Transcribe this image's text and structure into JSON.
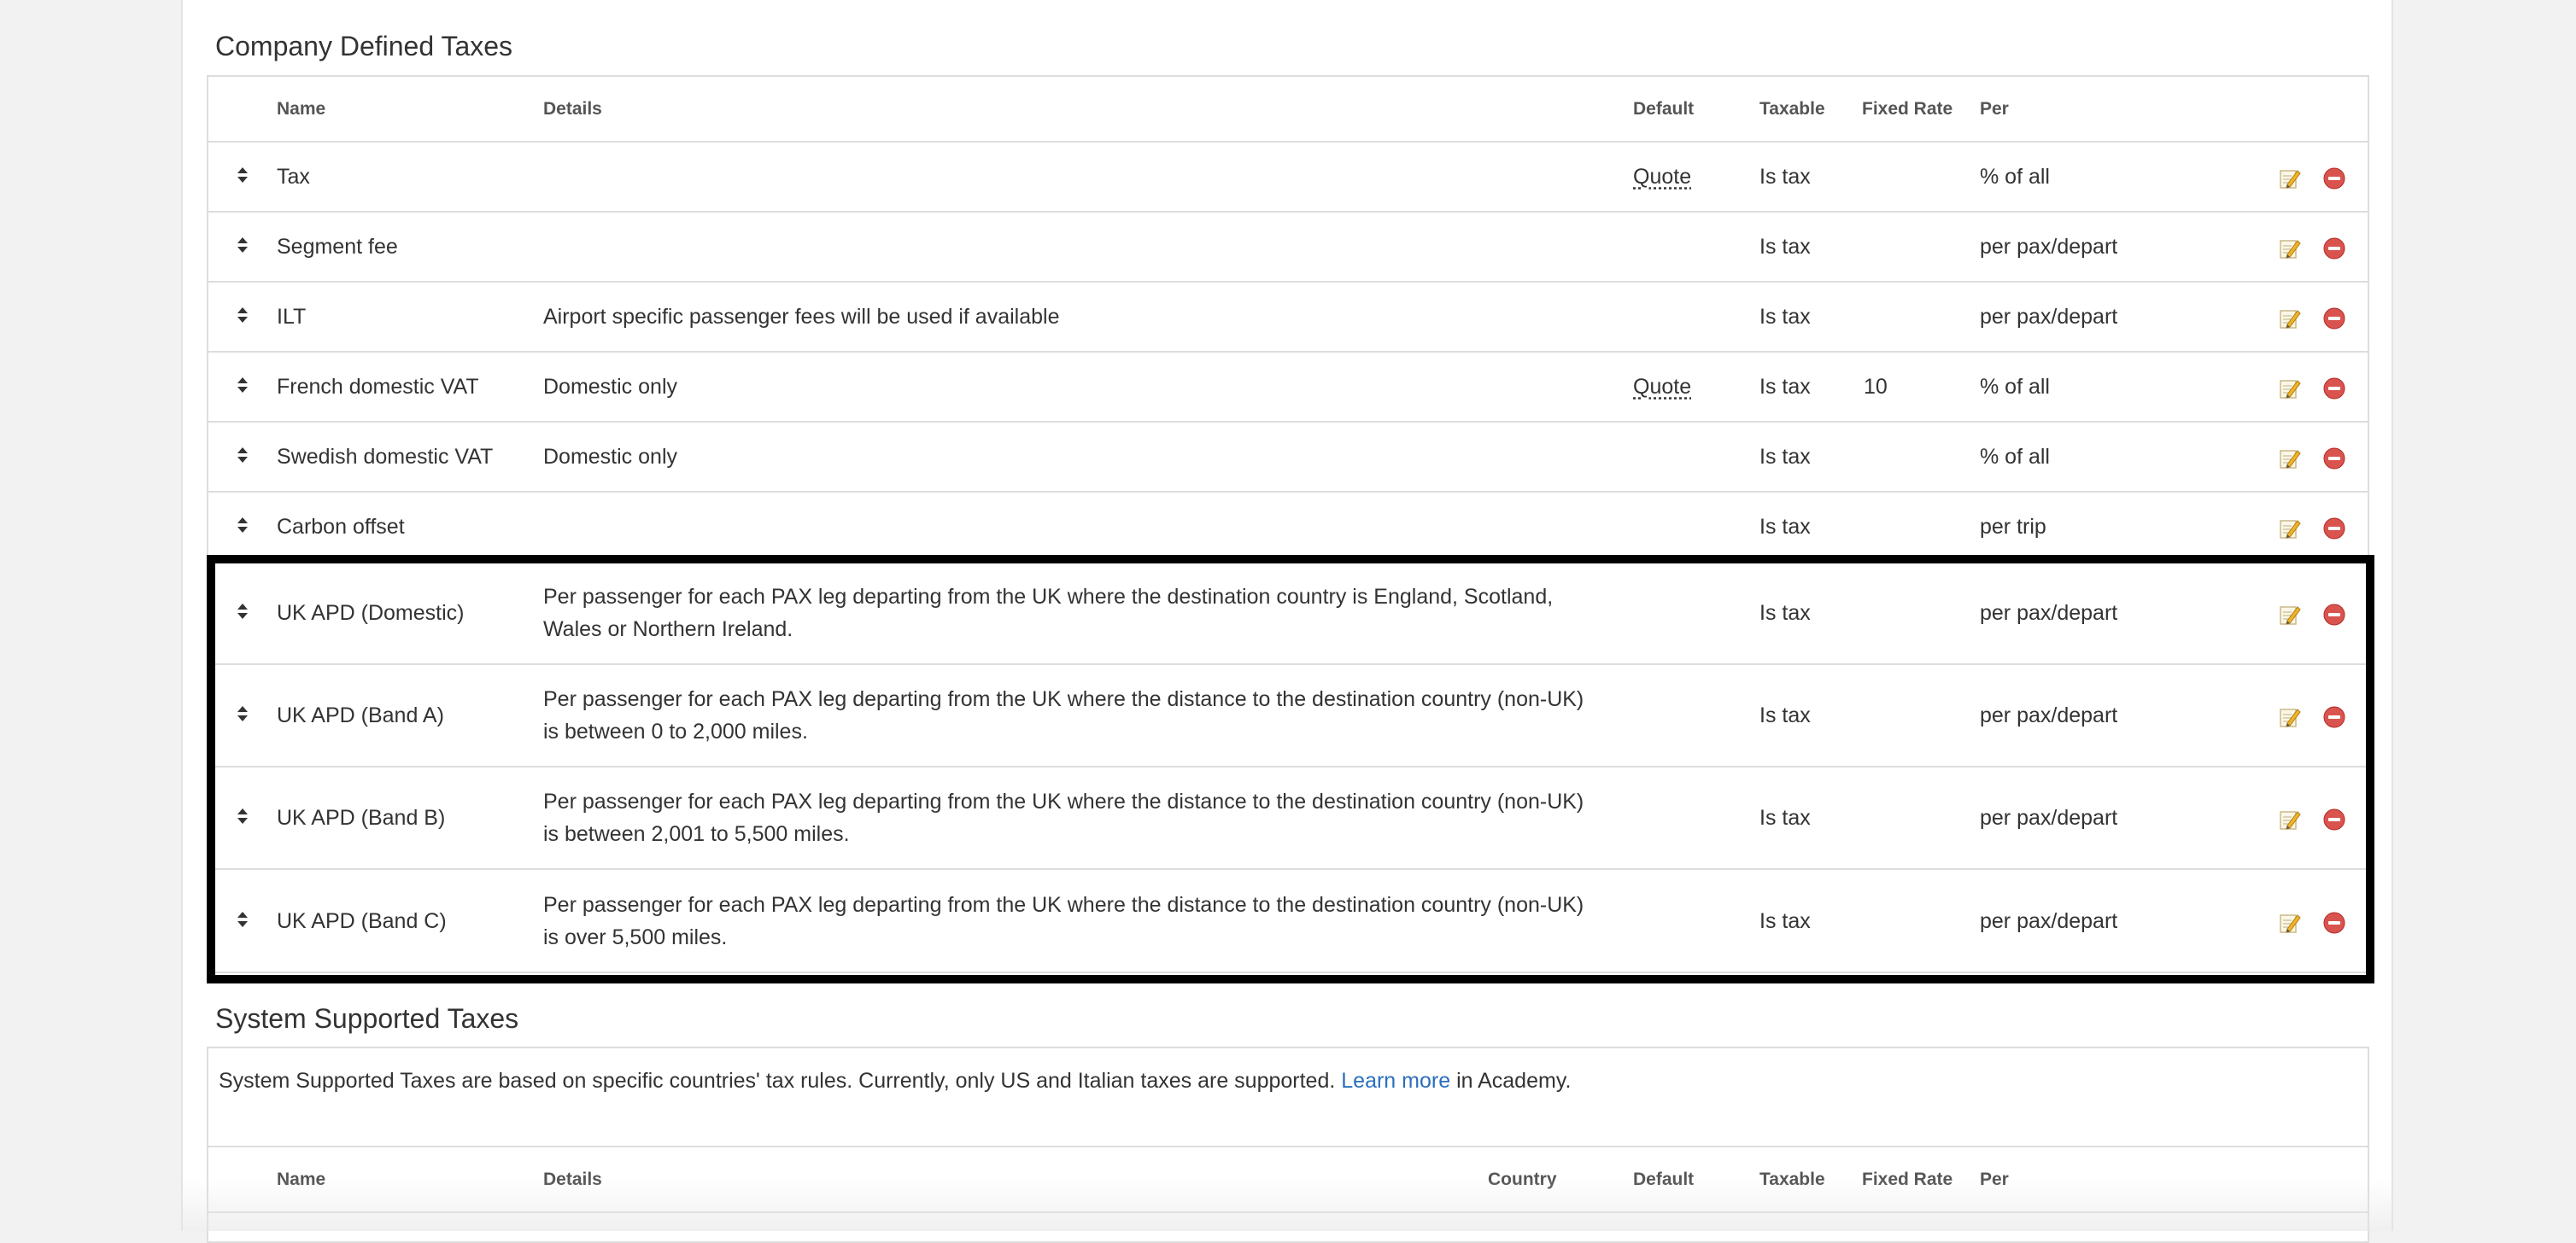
{
  "company_section": {
    "title": "Company Defined Taxes",
    "columns": {
      "name": "Name",
      "details": "Details",
      "default": "Default",
      "taxable": "Taxable",
      "fixed_rate": "Fixed Rate",
      "per": "Per"
    },
    "rows": [
      {
        "name": "Tax",
        "details": "",
        "default": "Quote",
        "taxable": "Is tax",
        "fixed_rate": "",
        "per": "% of all"
      },
      {
        "name": "Segment fee",
        "details": "",
        "default": "",
        "taxable": "Is tax",
        "fixed_rate": "",
        "per": "per pax/depart"
      },
      {
        "name": "ILT",
        "details": "Airport specific passenger fees will be used if available",
        "default": "",
        "taxable": "Is tax",
        "fixed_rate": "",
        "per": "per pax/depart"
      },
      {
        "name": "French domestic VAT",
        "details": "Domestic only",
        "default": "Quote",
        "taxable": "Is tax",
        "fixed_rate": "10",
        "per": "% of all"
      },
      {
        "name": "Swedish domestic VAT",
        "details": "Domestic only",
        "default": "",
        "taxable": "Is tax",
        "fixed_rate": "",
        "per": "% of all"
      },
      {
        "name": "Carbon offset",
        "details": "",
        "default": "",
        "taxable": "Is tax",
        "fixed_rate": "",
        "per": "per trip"
      },
      {
        "name": "UK APD (Domestic)",
        "details": "Per passenger for each PAX leg departing from the UK where the destination country is England, Scotland, Wales or Northern Ireland.",
        "default": "",
        "taxable": "Is tax",
        "fixed_rate": "",
        "per": "per pax/depart"
      },
      {
        "name": "UK APD (Band A)",
        "details": "Per passenger for each PAX leg departing from the UK where the distance to the destination country (non-UK) is between 0 to 2,000 miles.",
        "default": "",
        "taxable": "Is tax",
        "fixed_rate": "",
        "per": "per pax/depart"
      },
      {
        "name": "UK APD (Band B)",
        "details": "Per passenger for each PAX leg departing from the UK where the distance to the destination country (non-UK) is between 2,001 to 5,500 miles.",
        "default": "",
        "taxable": "Is tax",
        "fixed_rate": "",
        "per": "per pax/depart"
      },
      {
        "name": "UK APD (Band C)",
        "details": "Per passenger for each PAX leg departing from the UK where the distance to the destination country (non-UK) is over 5,500 miles.",
        "default": "",
        "taxable": "Is tax",
        "fixed_rate": "",
        "per": "per pax/depart"
      }
    ]
  },
  "system_section": {
    "title": "System Supported Taxes",
    "info_text": "System Supported Taxes are based on specific countries' tax rules. Currently, only US and Italian taxes are supported.",
    "learn_more_link": "Learn more",
    "info_suffix": "in Academy.",
    "columns": {
      "name": "Name",
      "details": "Details",
      "country": "Country",
      "default": "Default",
      "taxable": "Taxable",
      "fixed_rate": "Fixed Rate",
      "per": "Per"
    }
  },
  "icons": {
    "sort_handle": "sort-handle-icon",
    "edit": "edit-pencil-icon",
    "delete": "delete-minus-icon"
  },
  "colors": {
    "link": "#2a6ebb",
    "delete_red": "#d9534f",
    "highlight_border": "#000000"
  }
}
